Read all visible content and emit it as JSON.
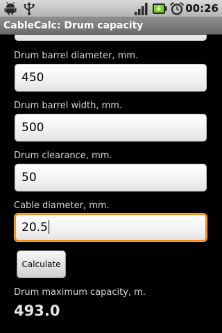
{
  "status_bar": {
    "time": "00:26",
    "icons": [
      "android-debug-icon",
      "usb-icon",
      "signal-icon",
      "battery-charging-icon",
      "alarm-clock-icon"
    ]
  },
  "app": {
    "title": "CableCalc: Drum capacity"
  },
  "form": {
    "fields": [
      {
        "label": "Drum barrel diameter, mm.",
        "value": "450"
      },
      {
        "label": "Drum barrel width, mm.",
        "value": "500"
      },
      {
        "label": "Drum clearance, mm.",
        "value": "50"
      },
      {
        "label": "Cable diameter, mm.",
        "value": "20.5"
      }
    ],
    "calculate_label": "Calculate"
  },
  "result": {
    "label": "Drum maximum capacity, m.",
    "value": "493.0"
  },
  "colors": {
    "focus_border": "#f28b13",
    "background": "#000000"
  }
}
